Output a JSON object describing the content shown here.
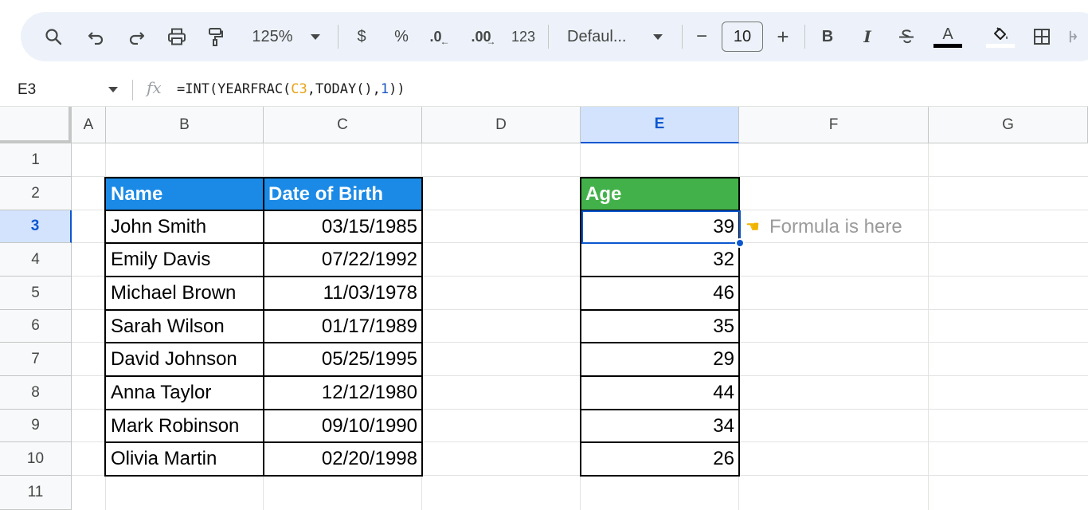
{
  "toolbar": {
    "zoom": "125%",
    "currency_label": "$",
    "percent_label": "%",
    "dec_decrease_label": ".0",
    "dec_increase_label": ".00",
    "number_format_label": "123",
    "font_name": "Defaul...",
    "font_size": "10",
    "minus_label": "−",
    "plus_label": "+",
    "bold_label": "B",
    "italic_label": "I",
    "text_color_label": "A"
  },
  "formula_bar": {
    "cell_ref": "E3",
    "fx_label": "fx",
    "formula_prefix": "=INT(YEARFRAC(",
    "formula_ref": "C3",
    "formula_mid": ",TODAY(),",
    "formula_num": "1",
    "formula_suffix": "))"
  },
  "columns": [
    "A",
    "B",
    "C",
    "D",
    "E",
    "F",
    "G"
  ],
  "rows": [
    "1",
    "2",
    "3",
    "4",
    "5",
    "6",
    "7",
    "8",
    "9",
    "10",
    "11"
  ],
  "selected_column": "E",
  "selected_row": "3",
  "table": {
    "headers": {
      "name": "Name",
      "dob": "Date of Birth",
      "age": "Age"
    },
    "people": [
      {
        "name": "John Smith",
        "dob": "03/15/1985",
        "age": "39"
      },
      {
        "name": "Emily Davis",
        "dob": "07/22/1992",
        "age": "32"
      },
      {
        "name": "Michael Brown",
        "dob": "11/03/1978",
        "age": "46"
      },
      {
        "name": "Sarah Wilson",
        "dob": "01/17/1989",
        "age": "35"
      },
      {
        "name": "David Johnson",
        "dob": "05/25/1995",
        "age": "29"
      },
      {
        "name": "Anna Taylor",
        "dob": "12/12/1980",
        "age": "44"
      },
      {
        "name": "Mark Robinson",
        "dob": "09/10/1990",
        "age": "34"
      },
      {
        "name": "Olivia Martin",
        "dob": "02/20/1998",
        "age": "26"
      }
    ]
  },
  "annotation": {
    "icon": "backhand-index-pointing-left-icon",
    "text": "Formula is here"
  },
  "colors": {
    "name_header_bg": "#1a8ae6",
    "age_header_bg": "#43b14a",
    "selection": "#0b57d0",
    "toolbar_bg": "#edf2fa"
  }
}
